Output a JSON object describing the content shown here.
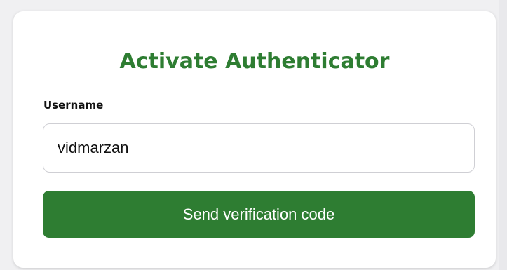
{
  "form": {
    "title": "Activate Authenticator",
    "username_label": "Username",
    "username_value": "vidmarzan",
    "submit_label": "Send verification code"
  },
  "colors": {
    "accent": "#2e7d32",
    "background": "#f0f0f2",
    "card": "#ffffff"
  }
}
